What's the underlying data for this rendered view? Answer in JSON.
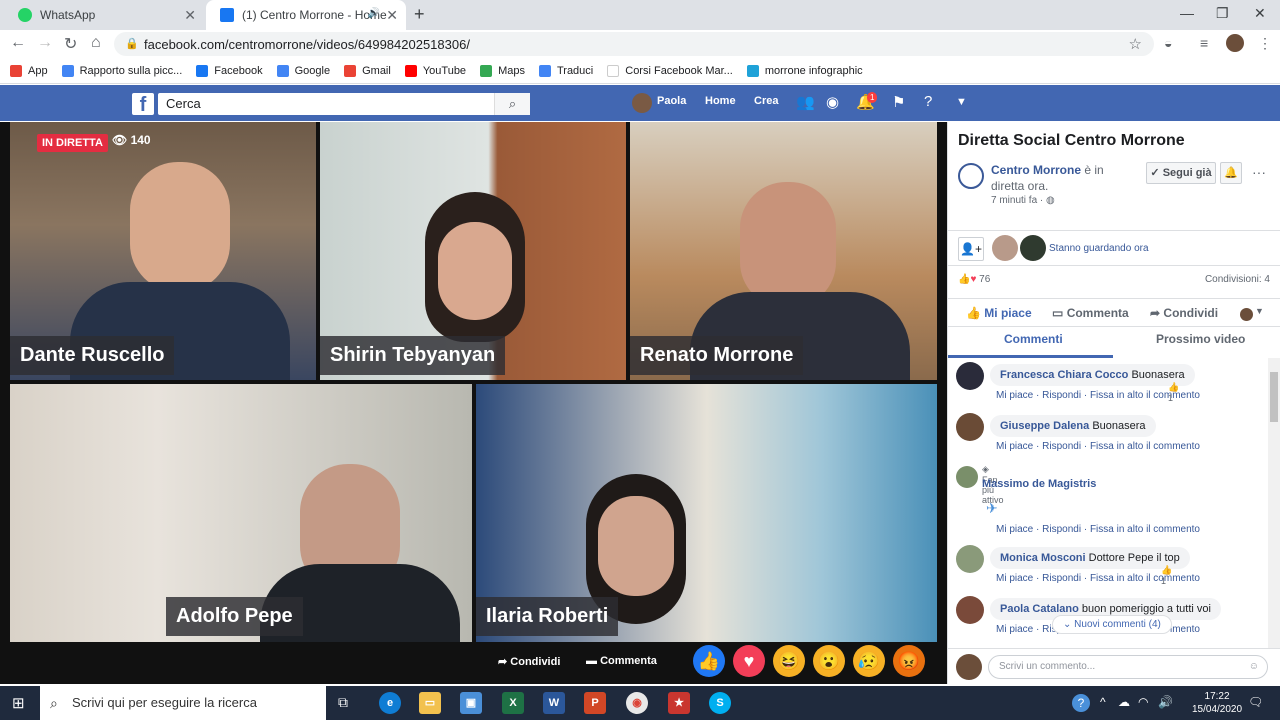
{
  "browser": {
    "tabs": [
      {
        "title": "WhatsApp",
        "active": false
      },
      {
        "title": "(1) Centro Morrone - Home",
        "active": true
      }
    ],
    "url": "facebook.com/centromorrone/videos/649984202518306/",
    "bookmarks": [
      "App",
      "Rapporto sulla picc...",
      "Facebook",
      "Google",
      "Gmail",
      "YouTube",
      "Maps",
      "Traduci",
      "Corsi Facebook Mar...",
      "morrone infographic"
    ]
  },
  "facebook": {
    "search_placeholder": "Cerca",
    "user": "Paola",
    "nav": {
      "home": "Home",
      "create": "Crea"
    },
    "notif_count": "1"
  },
  "video": {
    "live_label": "IN DIRETTA",
    "viewers": "140",
    "participants": [
      "Dante Ruscello",
      "Shirin Tebyanyan",
      "Renato Morrone",
      "Adolfo Pepe",
      "Ilaria Roberti"
    ],
    "share": "Condividi",
    "comment": "Commenta"
  },
  "panel": {
    "title": "Diretta Social Centro Morrone",
    "page_name": "Centro Morrone",
    "page_status": "è in diretta ora.",
    "time_ago": "7 minuti fa ·",
    "follow": "Segui già",
    "watching": "Stanno guardando ora",
    "reaction_count": "76",
    "shares": "Condivisioni: 4",
    "actions": {
      "like": "Mi piace",
      "comment": "Commenta",
      "share": "Condividi"
    },
    "tabs": {
      "comments": "Commenti",
      "next": "Prossimo video"
    },
    "link_labels": {
      "like": "Mi piace",
      "reply": "Rispondi",
      "pin": "Fissa in alto il commento"
    },
    "comments": [
      {
        "author": "Francesca Chiara Cocco",
        "text": "Buonasera",
        "likes": "1"
      },
      {
        "author": "Giuseppe Dalena",
        "text": "Buonasera",
        "likes": ""
      },
      {
        "badge": "Fan più attivo",
        "author": "Massimo de Magistris",
        "text": "",
        "likes": ""
      },
      {
        "author": "Monica Mosconi",
        "text": "Dottore Pepe il top",
        "likes": "1"
      },
      {
        "author": "Paola Catalano",
        "text": "buon pomeriggio a tutti voi",
        "likes": ""
      }
    ],
    "new_comments": "Nuovi commenti (4)",
    "write_placeholder": "Scrivi un commento..."
  },
  "taskbar": {
    "search": "Scrivi qui per eseguire la ricerca",
    "time": "17:22",
    "date": "15/04/2020"
  }
}
